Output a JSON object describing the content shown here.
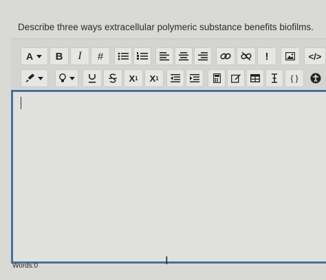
{
  "question": "Describe three ways extracellular polymeric substance benefits biofilms.",
  "toolbar": {
    "row1": {
      "font_label": "A",
      "bold_label": "B",
      "italic_label": "I",
      "heading_label": "#",
      "alert_label": "!",
      "code_label": "</>"
    },
    "row2": {
      "subscript_label": "X",
      "subscript_sub": "1",
      "superscript_label": "X",
      "superscript_sup": "1",
      "braces_label": "{ }"
    },
    "icons": [
      "font-dropdown-icon",
      "bold-icon",
      "italic-icon",
      "heading-icon",
      "bullet-list-icon",
      "numbered-list-icon",
      "align-left-icon",
      "align-center-icon",
      "align-right-icon",
      "link-icon",
      "unlink-icon",
      "alert-icon",
      "image-icon",
      "code-icon",
      "highlight-brush-icon",
      "lightbulb-icon",
      "underline-icon",
      "strikethrough-icon",
      "subscript-icon",
      "superscript-icon",
      "outdent-icon",
      "indent-icon",
      "calculator-icon",
      "edit-icon",
      "table-icon",
      "text-cursor-icon",
      "braces-icon",
      "accessibility-icon"
    ]
  },
  "footer": {
    "words_label": "Words:",
    "words_count": "0"
  },
  "colors": {
    "editor_border": "#4a6f9a",
    "background": "#d9d9d6"
  }
}
